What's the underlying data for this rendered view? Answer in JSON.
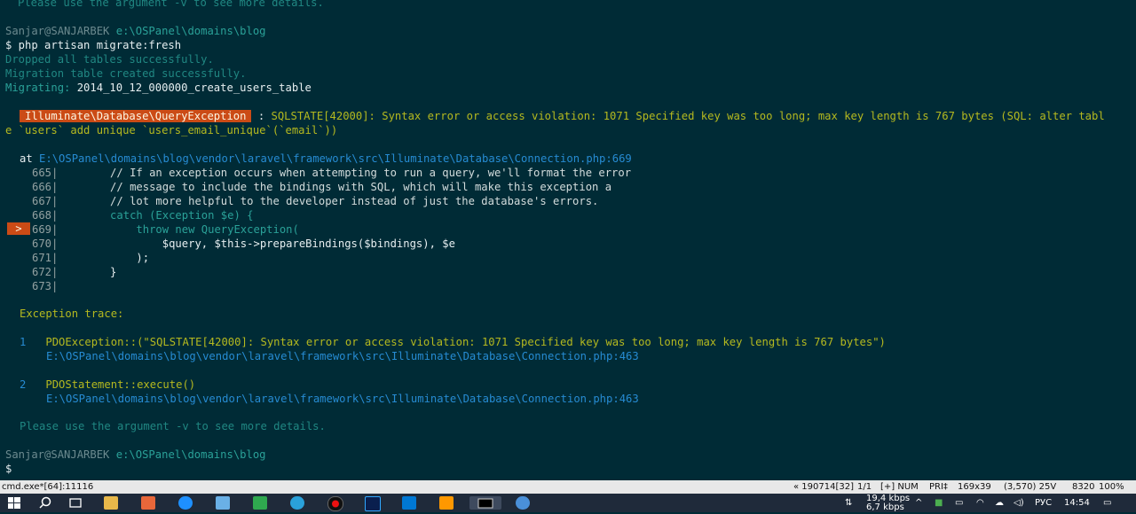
{
  "terminal": {
    "top_cut": "Please use the argument -v to see more details.",
    "prompt1_user": "Sanjar@SANJARBEK",
    "prompt1_path": "e:\\OSPanel\\domains\\blog",
    "cmd1": "$ php artisan migrate:fresh",
    "out1": "Dropped all tables successfully.",
    "out2": "Migration table created successfully.",
    "migrating_label": "Migrating:",
    "migrating_name": "2014_10_12_000000_create_users_table",
    "exception_class": "Illuminate\\Database\\QueryException",
    "exception_colon": " : ",
    "exception_msg_1": "SQLSTATE[42000]: Syntax error or access violation: 1071 Specified key was too long; max key length is 767 bytes (SQL: alter tabl",
    "exception_msg_2": "e `users` add unique `users_email_unique`(`email`))",
    "at_label": "at",
    "at_path": "E:\\OSPanel\\domains\\blog\\vendor\\laravel\\framework\\src\\Illuminate\\Database\\Connection.php",
    "at_line": ":669",
    "code": [
      {
        "num": "665",
        "text": "        // If an exception occurs when attempting to run a query, we'll format the error"
      },
      {
        "num": "666",
        "text": "        // message to include the bindings with SQL, which will make this exception a"
      },
      {
        "num": "667",
        "text": "        // lot more helpful to the developer instead of just the database's errors."
      },
      {
        "num": "668",
        "text": "        catch (Exception $e) {"
      },
      {
        "num": "669",
        "text": "            throw new QueryException("
      },
      {
        "num": "670",
        "text": "                $query, $this->prepareBindings($bindings), $e"
      },
      {
        "num": "671",
        "text": "            );"
      },
      {
        "num": "672",
        "text": "        }"
      },
      {
        "num": "673",
        "text": ""
      }
    ],
    "arrow": ">",
    "trace_title": "Exception trace:",
    "trace": [
      {
        "n": "1",
        "text": "PDOException::(\"SQLSTATE[42000]: Syntax error or access violation: 1071 Specified key was too long; max key length is 767 bytes\")",
        "path": "E:\\OSPanel\\domains\\blog\\vendor\\laravel\\framework\\src\\Illuminate\\Database\\Connection.php",
        "line": ":463"
      },
      {
        "n": "2",
        "text": "PDOStatement::execute()",
        "path": "E:\\OSPanel\\domains\\blog\\vendor\\laravel\\framework\\src\\Illuminate\\Database\\Connection.php",
        "line": ":463"
      }
    ],
    "hint": "Please use the argument -v to see more details.",
    "prompt2_user": "Sanjar@SANJARBEK",
    "prompt2_path": "e:\\OSPanel\\domains\\blog",
    "cursor": "$"
  },
  "statusbar": {
    "left": "cmd.exe*[64]:11116",
    "pos": "« 190714[32]",
    "pages": "1/1",
    "mode": "[+] NUM",
    "pri": "PRI‡",
    "size": "169x39",
    "coords": "(3,570) 25V",
    "pid": "8320",
    "zoom": "100%"
  },
  "taskbar": {
    "net_speed": "19,4 kbps",
    "net_speed2": "6,7 kbps",
    "lang": "РУС",
    "time": "14:54"
  },
  "colors": {
    "background": "#002b36",
    "accent": "#cb4b16",
    "yellow": "#b5b91f",
    "teal": "#268bd2"
  },
  "icons": [
    "start-icon",
    "search-icon",
    "task-view-icon",
    "file-explorer-icon",
    "app-icon",
    "app-icon",
    "app-icon",
    "app-icon",
    "telegram-icon",
    "recorder-icon",
    "photoshop-icon",
    "vscode-icon",
    "sublime-icon",
    "console-icon",
    "app-icon"
  ]
}
